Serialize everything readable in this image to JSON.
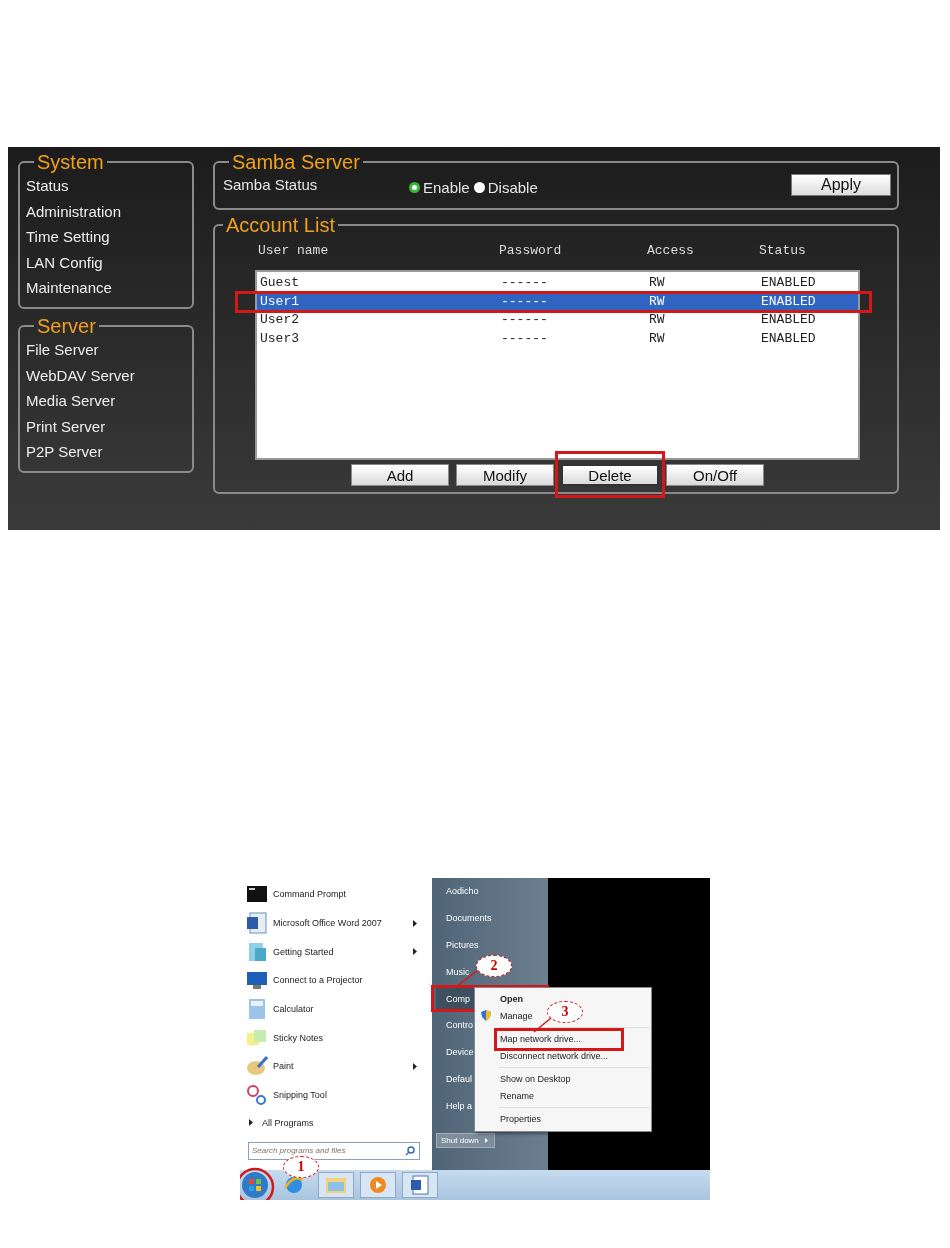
{
  "nas_panel": {
    "system": {
      "title": "System",
      "items": [
        "Status",
        "Administration",
        "Time Setting",
        "LAN Config",
        "Maintenance"
      ]
    },
    "server": {
      "title": "Server",
      "items": [
        "File Server",
        "WebDAV Server",
        "Media Server",
        "Print Server",
        "P2P Server"
      ]
    },
    "samba": {
      "title": "Samba Server",
      "label": "Samba Status",
      "options": [
        {
          "label": "Enable",
          "selected": true
        },
        {
          "label": "Disable",
          "selected": false
        }
      ],
      "apply": "Apply"
    },
    "account_list": {
      "title": "Account List",
      "columns": [
        "User name",
        "Password",
        "Access",
        "Status"
      ],
      "rows": [
        {
          "cells": [
            "Guest",
            "------",
            "RW",
            "ENABLED"
          ],
          "selected": false,
          "annotated": false
        },
        {
          "cells": [
            "User1",
            "------",
            "RW",
            "ENABLED"
          ],
          "selected": true,
          "annotated": true
        },
        {
          "cells": [
            "User2",
            "------",
            "RW",
            "ENABLED"
          ],
          "selected": false,
          "annotated": false
        },
        {
          "cells": [
            "User3",
            "------",
            "RW",
            "ENABLED"
          ],
          "selected": false,
          "annotated": false
        }
      ],
      "buttons": [
        {
          "label": "Add",
          "annotated": false
        },
        {
          "label": "Modify",
          "annotated": false
        },
        {
          "label": "Delete",
          "annotated": true
        },
        {
          "label": "On/Off",
          "annotated": false
        }
      ]
    }
  },
  "start_menu": {
    "programs": [
      {
        "label": "Command Prompt",
        "submenu": false
      },
      {
        "label": "Microsoft Office Word 2007",
        "submenu": true
      },
      {
        "label": "Getting Started",
        "submenu": true
      },
      {
        "label": "Connect to a Projector",
        "submenu": false
      },
      {
        "label": "Calculator",
        "submenu": false
      },
      {
        "label": "Sticky Notes",
        "submenu": false
      },
      {
        "label": "Paint",
        "submenu": true
      },
      {
        "label": "Snipping Tool",
        "submenu": false
      }
    ],
    "all_programs": "All Programs",
    "search": {
      "placeholder": "Search programs and files"
    },
    "places": [
      {
        "label": "Aodicho",
        "annotated": false
      },
      {
        "label": "Documents",
        "annotated": false
      },
      {
        "label": "Pictures",
        "annotated": false
      },
      {
        "label": "Music",
        "annotated": false
      },
      {
        "label": "Comp",
        "annotated": true,
        "callout": "2"
      },
      {
        "label": "Contro",
        "annotated": false
      },
      {
        "label": "Device",
        "annotated": false
      },
      {
        "label": "Defaul",
        "annotated": false
      },
      {
        "label": "Help a",
        "annotated": false
      }
    ],
    "shutdown": "Shut down",
    "context_menu": [
      {
        "kind": "item",
        "label": "Open",
        "default": true,
        "annotated": false
      },
      {
        "kind": "item",
        "label": "Manage",
        "default": false,
        "annotated": false,
        "shield": true
      },
      {
        "kind": "separator"
      },
      {
        "kind": "item",
        "label": "Map network drive...",
        "default": false,
        "annotated": true,
        "callout": "3"
      },
      {
        "kind": "item",
        "label": "Disconnect network drive...",
        "default": false,
        "annotated": false
      },
      {
        "kind": "separator"
      },
      {
        "kind": "item",
        "label": "Show on Desktop",
        "default": false,
        "annotated": false
      },
      {
        "kind": "item",
        "label": "Rename",
        "default": false,
        "annotated": false
      },
      {
        "kind": "separator"
      },
      {
        "kind": "item",
        "label": "Properties",
        "default": false,
        "annotated": false
      }
    ],
    "start_button": {
      "annotated": true,
      "callout": "1"
    }
  }
}
